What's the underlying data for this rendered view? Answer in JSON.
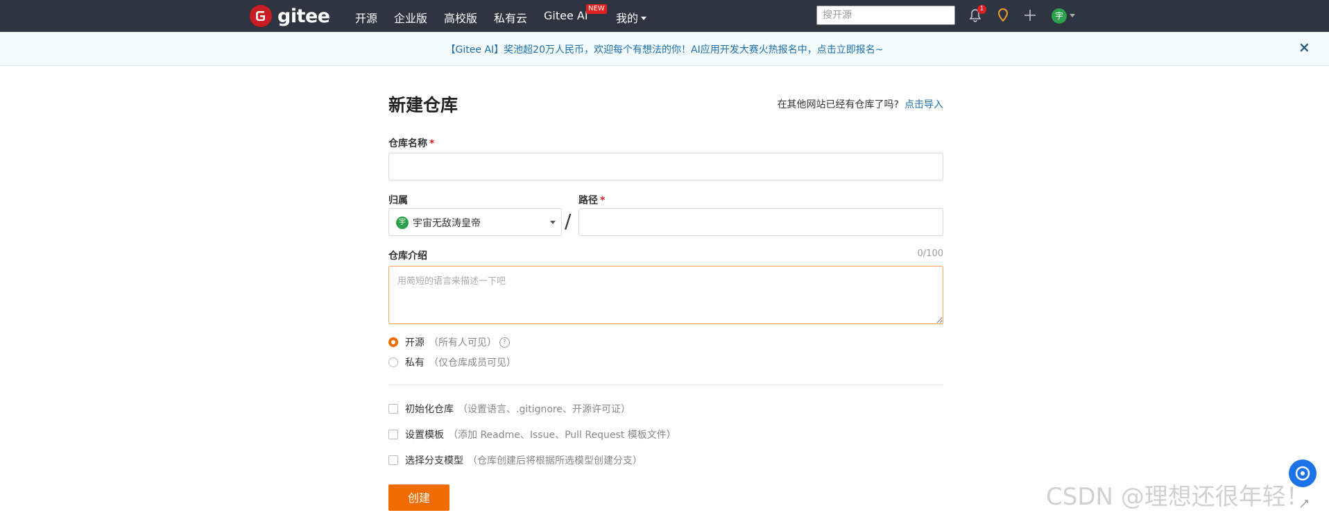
{
  "brand": {
    "name": "gitee",
    "accent": "#c71d23"
  },
  "nav": {
    "items": [
      "开源",
      "企业版",
      "高校版",
      "私有云",
      "Gitee AI"
    ],
    "new_badge": "NEW",
    "mine": "我的",
    "search_placeholder": "搜开源",
    "notification_count": "1",
    "user_initial": "宇"
  },
  "banner": {
    "text": "【Gitee AI】奖池超20万人民币，欢迎每个有想法的你！AI应用开发大赛火热报名中，点击立即报名~",
    "close": "×"
  },
  "form": {
    "title": "新建仓库",
    "import_hint": "在其他网站已经有仓库了吗?",
    "import_link": "点击导入",
    "repo_name_label": "仓库名称",
    "required_mark": "*",
    "owner_label": "归属",
    "owner_name": "宇宙无敌涛皇帝",
    "owner_initial": "宇",
    "slash": "/",
    "path_label": "路径",
    "desc_label": "仓库介绍",
    "desc_counter": "0/100",
    "desc_placeholder": "用简短的语言来描述一下吧",
    "visibility": [
      {
        "label": "开源",
        "hint": "（所有人可见）",
        "selected": true
      },
      {
        "label": "私有",
        "hint": "（仅仓库成员可见）",
        "selected": false
      }
    ],
    "help": "?",
    "options": [
      {
        "label": "初始化仓库",
        "hint": "（设置语言、.gitignore、开源许可证）"
      },
      {
        "label": "设置模板",
        "hint": "（添加 Readme、Issue、Pull Request 模板文件）"
      },
      {
        "label": "选择分支模型",
        "hint": "（仓库创建后将根据所选模型创建分支）"
      }
    ],
    "submit": "创建"
  },
  "watermark": "CSDN @理想还很年轻！",
  "colors": {
    "topbar": "#2e3440",
    "primary": "#f06c00",
    "link": "#1c6fb0"
  }
}
